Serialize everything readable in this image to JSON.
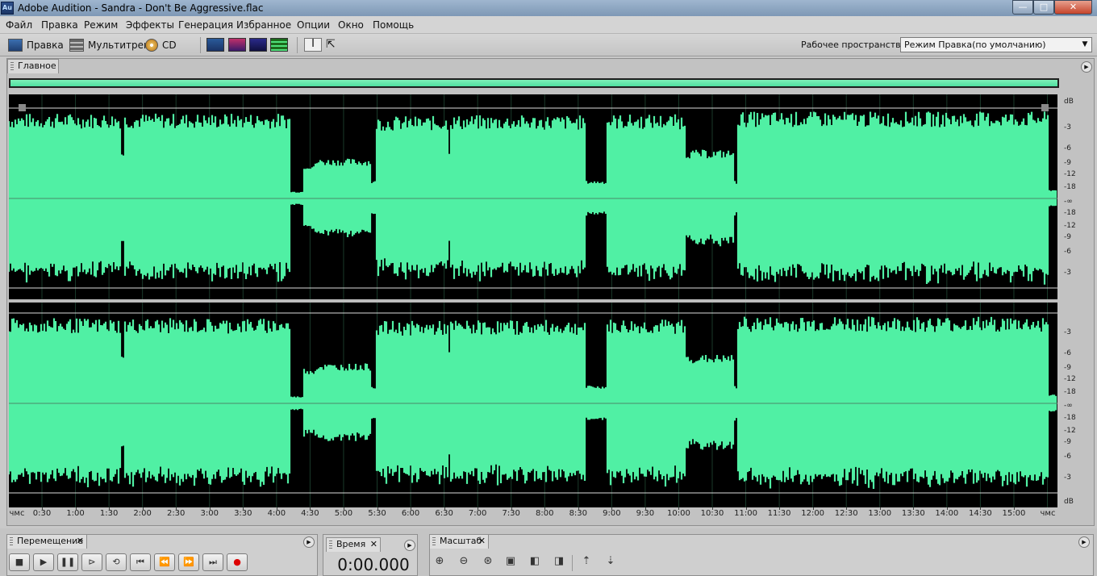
{
  "window": {
    "app_icon": "Au",
    "title": "Adobe Audition - Sandra - Don't Be Aggressive.flac",
    "buttons": {
      "minimize": "—",
      "maximize": "□",
      "close": "✕"
    }
  },
  "menu": [
    "Файл",
    "Правка",
    "Режим",
    "Эффекты",
    "Генерация",
    "Избранное",
    "Опции",
    "Окно",
    "Помощь"
  ],
  "toolbar": {
    "modes": [
      "Правка",
      "Мультитрек",
      "CD"
    ],
    "workspace_label": "Рабочее пространство:",
    "workspace_value": "Режим Правка(по умолчанию)"
  },
  "main_panel": {
    "tab": "Главное"
  },
  "db_ruler": {
    "channel1": [
      "dB",
      "-3",
      "-6",
      "-9",
      "-12",
      "-18",
      "-∞",
      "-18",
      "-12",
      "-9",
      "-6",
      "-3"
    ],
    "channel2": [
      "-3",
      "-6",
      "-9",
      "-12",
      "-18",
      "-∞",
      "-18",
      "-12",
      "-9",
      "-6",
      "-3",
      "dB"
    ]
  },
  "time_ruler": {
    "start_label": "чмс",
    "end_label": "чмс",
    "labels": [
      "0:30",
      "1:00",
      "1:30",
      "2:00",
      "2:30",
      "3:00",
      "3:30",
      "4:00",
      "4:30",
      "5:00",
      "5:30",
      "6:00",
      "6:30",
      "7:00",
      "7:30",
      "8:00",
      "8:30",
      "9:00",
      "9:30",
      "10:00",
      "10:30",
      "11:00",
      "11:30",
      "12:00",
      "12:30",
      "13:00",
      "13:30",
      "14:00",
      "14:30",
      "15:00"
    ]
  },
  "panels": {
    "transport": "Перемещение",
    "time": "Время",
    "zoom": "Масштаб"
  },
  "time_display": "0:00.000",
  "colors": {
    "waveform": "#50f0a4",
    "background": "#000000"
  }
}
